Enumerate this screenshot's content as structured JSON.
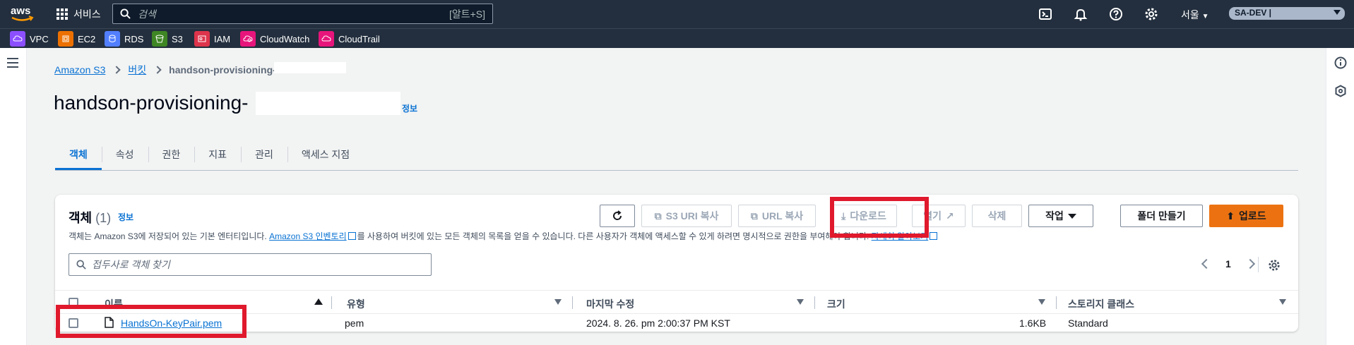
{
  "topnav": {
    "logo": "aws",
    "services_label": "서비스",
    "search_placeholder": "검색",
    "search_shortcut": "[알트+S]",
    "region": "서울",
    "account": "SA-DEV |"
  },
  "favorites": [
    {
      "label": "VPC",
      "icon": "vpc-icon",
      "color": "#8c4fff"
    },
    {
      "label": "EC2",
      "icon": "ec2-icon",
      "color": "#ed7100"
    },
    {
      "label": "RDS",
      "icon": "rds-icon",
      "color": "#527fff"
    },
    {
      "label": "S3",
      "icon": "s3-icon",
      "color": "#3f8624"
    },
    {
      "label": "IAM",
      "icon": "iam-icon",
      "color": "#dd344c"
    },
    {
      "label": "CloudWatch",
      "icon": "cloudwatch-icon",
      "color": "#e7157b"
    },
    {
      "label": "CloudTrail",
      "icon": "cloudtrail-icon",
      "color": "#e7157b"
    }
  ],
  "breadcrumb": {
    "root": "Amazon S3",
    "buckets": "버킷",
    "current": "handson-provisioning-"
  },
  "page": {
    "title": "handson-provisioning-",
    "info": "정보"
  },
  "tabs": [
    "객체",
    "속성",
    "권한",
    "지표",
    "관리",
    "액세스 지점"
  ],
  "objects_panel": {
    "title": "객체",
    "count": "(1)",
    "info": "정보",
    "desc_pre": "객체는 Amazon S3에 저장되어 있는 기본 엔터티입니다. ",
    "desc_link": "Amazon S3 인벤토리",
    "desc_mid": "를 사용하여 버킷에 있는 모든 객체의 목록을 얻을 수 있습니다. 다른 사용자가 객체에 액세스할 수 있게 하려면 명시적으로 권한을 부여해야 합니다. ",
    "desc_link2": "자세히 알아보기",
    "buttons": {
      "copy_s3_uri": "S3 URI 복사",
      "copy_url": "URL 복사",
      "download": "다운로드",
      "open": "열기",
      "delete": "삭제",
      "actions": "작업",
      "create_folder": "폴더 만들기",
      "upload": "업로드"
    },
    "filter_placeholder": "접두사로 객체 찾기",
    "page_number": "1",
    "columns": [
      "이름",
      "유형",
      "마지막 수정",
      "크기",
      "스토리지 클래스"
    ],
    "rows": [
      {
        "name": "HandsOn-KeyPair.pem",
        "type": "pem",
        "modified": "2024. 8. 26. pm 2:00:37 PM KST",
        "size": "1.6KB",
        "storage_class": "Standard"
      }
    ]
  },
  "highlight_color": "#e0192d"
}
